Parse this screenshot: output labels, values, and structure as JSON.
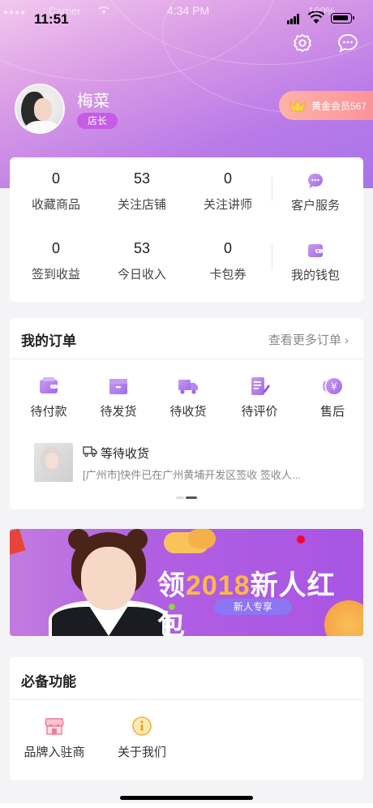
{
  "status_bar": {
    "time": "11:51",
    "carrier": "Carrier",
    "overlay_time": "4:34 PM",
    "battery_percent": "100%"
  },
  "profile": {
    "name": "梅菜",
    "role": "店长",
    "vip_label": "黄金会员567"
  },
  "stats": {
    "row1": [
      {
        "value": "0",
        "label": "收藏商品"
      },
      {
        "value": "53",
        "label": "关注店铺"
      },
      {
        "value": "0",
        "label": "关注讲师"
      }
    ],
    "row2": [
      {
        "value": "0",
        "label": "签到收益"
      },
      {
        "value": "53",
        "label": "今日收入"
      },
      {
        "value": "0",
        "label": "卡包券"
      }
    ],
    "service_label": "客户服务",
    "wallet_label": "我的钱包"
  },
  "orders": {
    "title": "我的订单",
    "more": "查看更多订单",
    "items": [
      {
        "label": "待付款",
        "icon": "wallet-icon"
      },
      {
        "label": "待发货",
        "icon": "package-icon"
      },
      {
        "label": "待收货",
        "icon": "truck-icon"
      },
      {
        "label": "待评价",
        "icon": "review-icon"
      },
      {
        "label": "售后",
        "icon": "after-sale-icon"
      }
    ],
    "tracking": {
      "title": "等待收货",
      "text": "[广州市]快件已在广州黄埔开发区签收 签收人..."
    }
  },
  "banner": {
    "headline_prefix": "领",
    "headline_year": "2018",
    "headline_suffix": "新人红包",
    "button": "新人专享"
  },
  "functions": {
    "title": "必备功能",
    "items": [
      {
        "label": "品牌入驻商",
        "icon": "shop-icon"
      },
      {
        "label": "关于我们",
        "icon": "info-icon"
      }
    ]
  },
  "colors": {
    "accent_purple": "#b97ae8",
    "icon_gradient_start": "#c99cf0",
    "icon_gradient_end": "#a06ae8",
    "vip_pink": "#fb8f98"
  }
}
